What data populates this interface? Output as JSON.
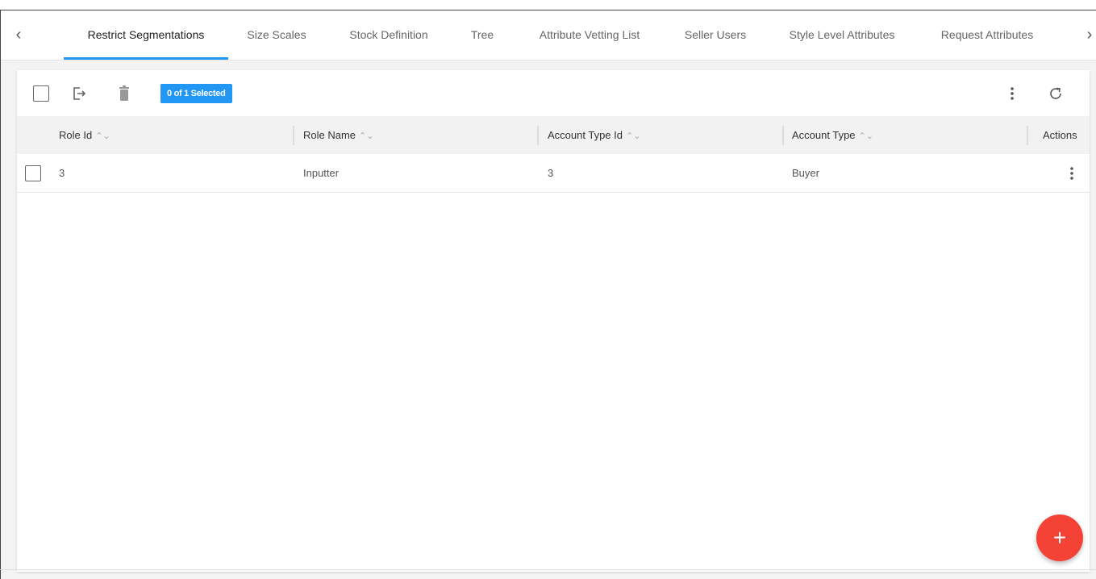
{
  "nav": {
    "prev_icon": "chevron-left-icon",
    "next_icon": "chevron-right-icon",
    "tabs": [
      {
        "label": "Restrict Segmentations",
        "active": true
      },
      {
        "label": "Size Scales",
        "active": false
      },
      {
        "label": "Stock Definition",
        "active": false
      },
      {
        "label": "Tree",
        "active": false
      },
      {
        "label": "Attribute Vetting List",
        "active": false
      },
      {
        "label": "Seller Users",
        "active": false
      },
      {
        "label": "Style Level Attributes",
        "active": false
      },
      {
        "label": "Request Attributes",
        "active": false
      }
    ]
  },
  "toolbar": {
    "selected_badge": "0 of 1 Selected",
    "icons": [
      "select-all-checkbox",
      "export-icon",
      "delete-icon",
      "more-vert-icon",
      "refresh-icon"
    ]
  },
  "table": {
    "columns": [
      "Role Id",
      "Role Name",
      "Account Type Id",
      "Account Type",
      "Actions"
    ],
    "sort_glyph": "⌃⌄",
    "rows": [
      {
        "role_id": "3",
        "role_name": "Inputter",
        "account_type_id": "3",
        "account_type": "Buyer"
      }
    ]
  },
  "fab": {
    "label": "+",
    "icon": "add-icon"
  },
  "colors": {
    "accent": "#2196f3",
    "fab": "#f44336"
  }
}
